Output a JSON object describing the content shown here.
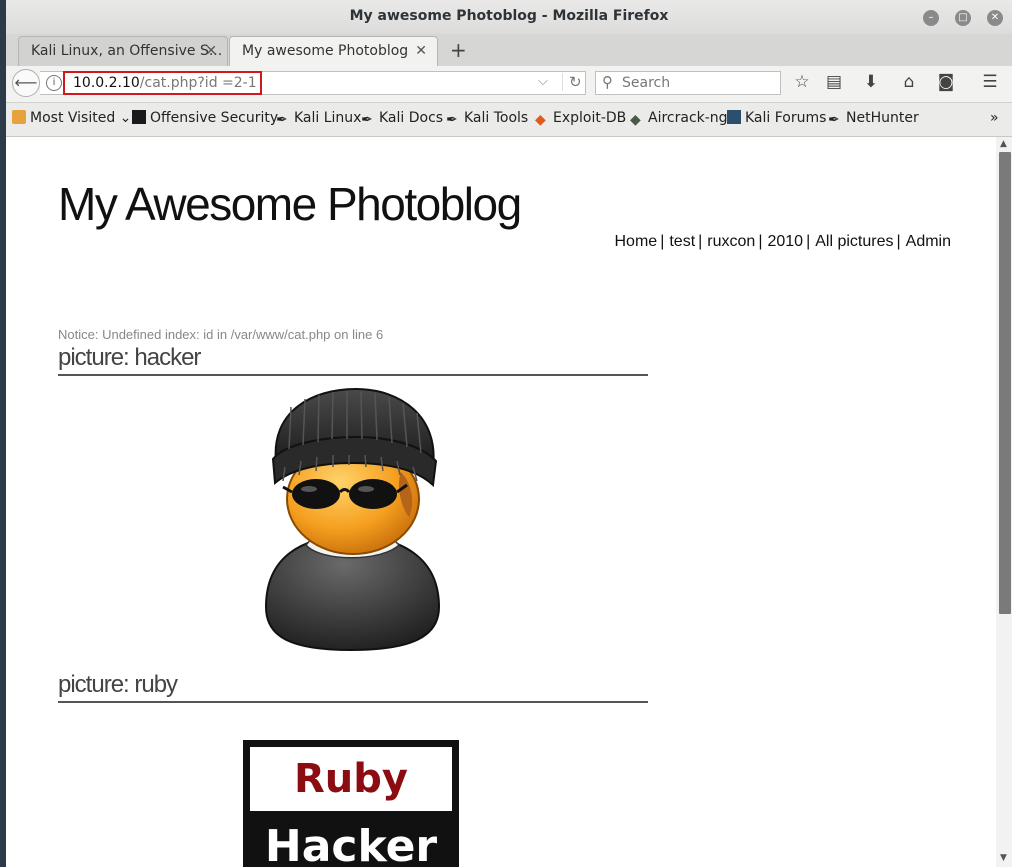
{
  "window": {
    "title": "My awesome Photoblog - Mozilla Firefox"
  },
  "tabs": [
    {
      "label": "Kali Linux, an Offensive S..."
    },
    {
      "label": "My awesome Photoblog"
    }
  ],
  "address": {
    "host": "10.0.2.10",
    "path": "/cat.php?id =2-1"
  },
  "search": {
    "placeholder": "Search"
  },
  "bookmarks": [
    {
      "label": "Most Visited"
    },
    {
      "label": "Offensive Security"
    },
    {
      "label": "Kali Linux"
    },
    {
      "label": "Kali Docs"
    },
    {
      "label": "Kali Tools"
    },
    {
      "label": "Exploit-DB"
    },
    {
      "label": "Aircrack-ng"
    },
    {
      "label": "Kali Forums"
    },
    {
      "label": "NetHunter"
    }
  ],
  "page": {
    "site_title": "My Awesome Photoblog",
    "nav": [
      "Home",
      "test",
      "ruxcon",
      "2010",
      "All pictures",
      "Admin"
    ],
    "notice": "Notice: Undefined index: id in /var/www/cat.php on line 6",
    "pictures": [
      {
        "heading": "picture: hacker"
      },
      {
        "heading": "picture: ruby",
        "logo_top": "Ruby",
        "logo_bottom": "Hacker"
      }
    ]
  },
  "colors": {
    "url_highlight": "#d0181e",
    "ruby_red": "#8b0d12"
  }
}
